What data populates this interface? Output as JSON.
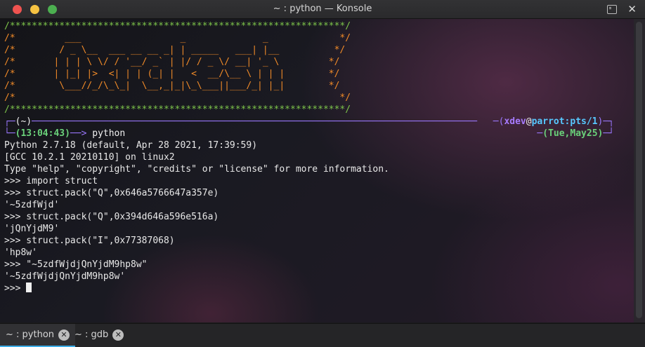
{
  "window": {
    "title": "~ : python — Konsole"
  },
  "banner": [
    "/*************************************************************/",
    "/*         ___                  _              _             */",
    "/*        / _ \\__  ___ __ __ _| | _____   ___| |__          */",
    "/*       | | | \\ \\/ / '__/ _` | |/ / _ \\/ __| '_ \\         */",
    "/*       | |_| |>  <| | | (_| |   <  __/\\__ \\ | | |        */",
    "/*        \\___//_/\\_\\_|  \\__,_|_|\\_\\___||___/_| |_|        */",
    "/*                                                           */",
    "/*************************************************************/"
  ],
  "prompt": {
    "dir": "(~)",
    "time": "(13:04:43)",
    "command": "python",
    "user": "xdev",
    "host": "parrot:pts/1",
    "date": "(Tue,May25)"
  },
  "output": [
    "Python 2.7.18 (default, Apr 28 2021, 17:39:59)",
    "[GCC 10.2.1 20210110] on linux2",
    "Type \"help\", \"copyright\", \"credits\" or \"license\" for more information.",
    ">>> import struct",
    ">>> struct.pack(\"Q\",0x646a5766647a357e)",
    "'~5zdfWjd'",
    ">>> struct.pack(\"Q\",0x394d646a596e516a)",
    "'jQnYjdM9'",
    ">>> struct.pack(\"I\",0x77387068)",
    "'hp8w'",
    ">>> \"~5zdfWjdjQnYjdM9hp8w\"",
    "'~5zdfWjdjQnYjdM9hp8w'"
  ],
  "current_prompt": ">>> ",
  "tabs": [
    {
      "label": "~ : python",
      "active": true
    },
    {
      "label": "~ : gdb",
      "active": false
    }
  ]
}
